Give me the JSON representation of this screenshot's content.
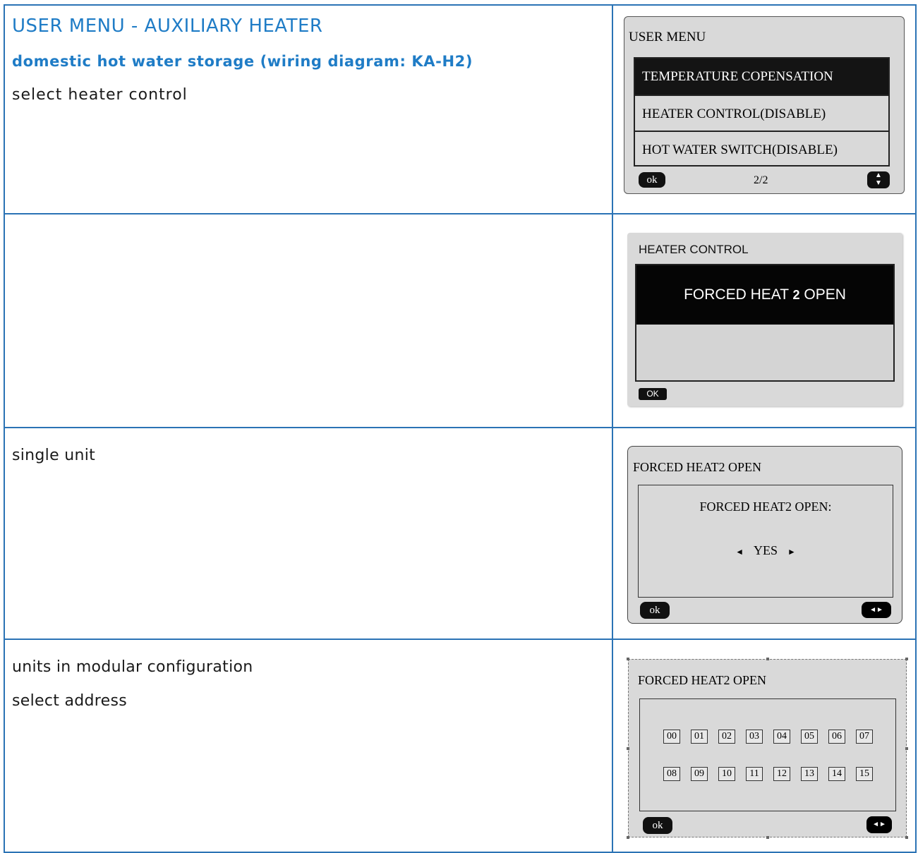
{
  "section": {
    "title": "USER MENU - AUXILIARY HEATER",
    "subtitle": "domestic hot water storage (wiring diagram: KA-H2)",
    "step1_text": "select heater control",
    "step3_text": "single unit",
    "step4_text_line1": "units in modular configuration",
    "step4_text_line2": "select address"
  },
  "screen1": {
    "header": "USER MENU",
    "items": [
      "TEMPERATURE COPENSATION",
      "HEATER CONTROL(DISABLE)",
      "HOT WATER SWITCH(DISABLE)"
    ],
    "ok_label": "ok",
    "page": "2/2",
    "updown_icon": "up-down-arrows-icon"
  },
  "screen2": {
    "header": "HEATER CONTROL",
    "selected_prefix": "FORCED HEAT ",
    "selected_num": "2",
    "selected_suffix": " OPEN",
    "ok_label": "OK"
  },
  "screen3": {
    "header": "FORCED HEAT2 OPEN",
    "question": "FORCED HEAT2 OPEN:",
    "value": "YES",
    "ok_label": "ok",
    "left_arrow": "◄",
    "right_arrow": "►"
  },
  "screen4": {
    "header": "FORCED HEAT2 OPEN",
    "addresses_row1": [
      "00",
      "01",
      "02",
      "03",
      "04",
      "05",
      "06",
      "07"
    ],
    "addresses_row2": [
      "08",
      "09",
      "10",
      "11",
      "12",
      "13",
      "14",
      "15"
    ],
    "ok_label": "ok"
  },
  "colors": {
    "border": "#2b73b5",
    "title": "#1f7cc6",
    "screen_bg": "#d9d9d9"
  }
}
